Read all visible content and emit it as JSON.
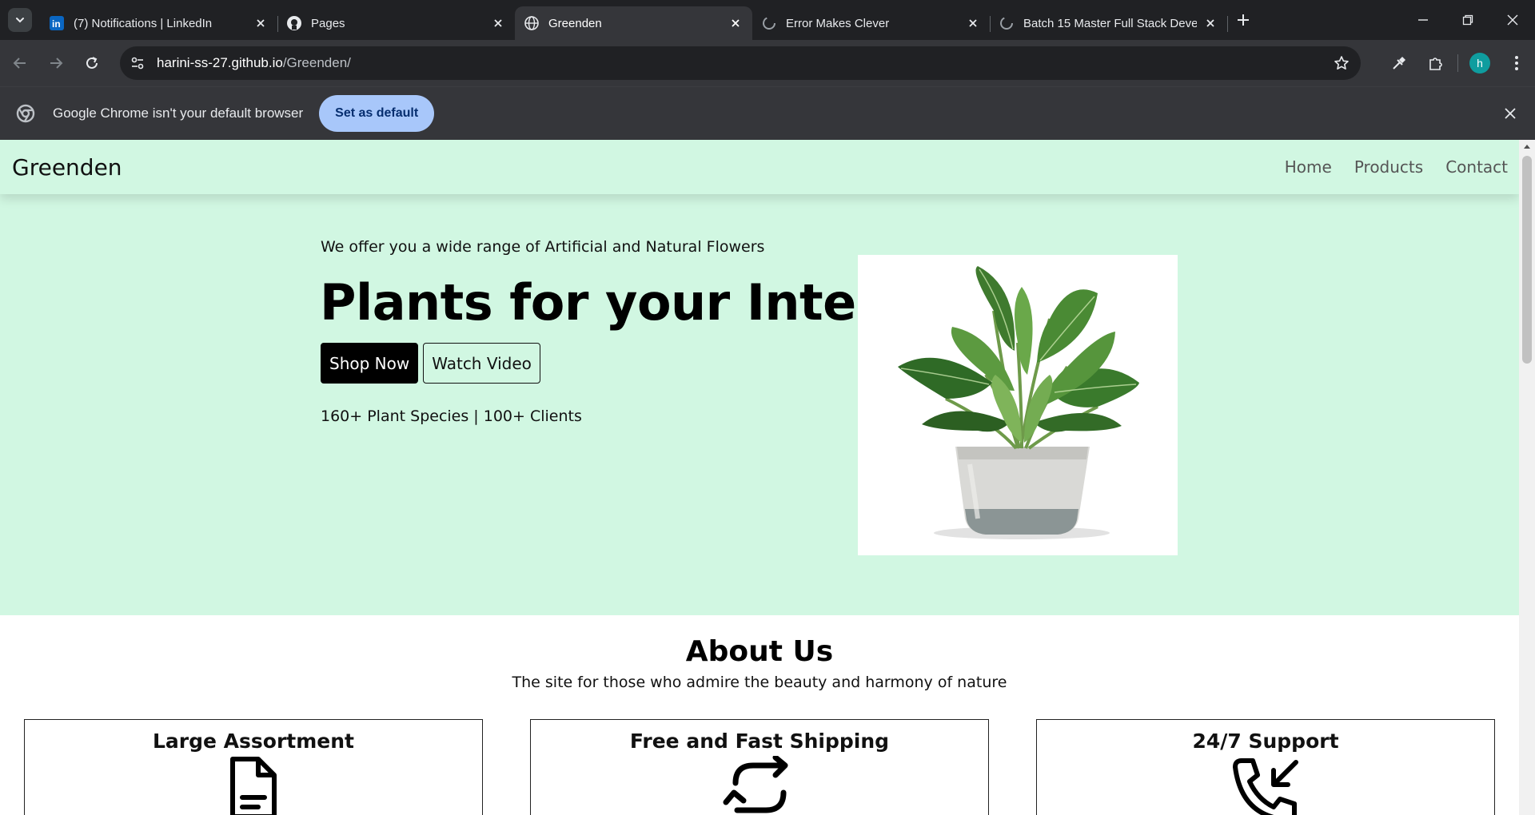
{
  "browser": {
    "tabs": [
      {
        "title": "(7) Notifications | LinkedIn",
        "favicon": "linkedin-icon",
        "active": false
      },
      {
        "title": "Pages",
        "favicon": "github-icon",
        "active": false
      },
      {
        "title": "Greenden",
        "favicon": "globe-icon",
        "active": true
      },
      {
        "title": "Error Makes Clever",
        "favicon": "emc-icon",
        "active": false
      },
      {
        "title": "Batch 15 Master Full Stack Deve",
        "favicon": "emc-icon",
        "active": false
      }
    ],
    "url_host": "harini-ss-27.github.io",
    "url_path": "/Greenden/",
    "profile_initial": "h",
    "infobar": {
      "message": "Google Chrome isn't your default browser",
      "button_label": "Set as default"
    }
  },
  "site": {
    "brand": "Greenden",
    "nav": [
      "Home",
      "Products",
      "Contact"
    ],
    "hero": {
      "subtitle": "We offer you a wide range of Artificial and Natural Flowers",
      "title": "Plants for your Interior",
      "shop_button": "Shop Now",
      "video_button": "Watch Video",
      "stats": "160+ Plant Species | 100+ Clients"
    },
    "about": {
      "title": "About Us",
      "subtitle": "The site for those who admire the beauty and harmony of nature",
      "cards": [
        {
          "title": "Large Assortment",
          "icon": "document-icon"
        },
        {
          "title": "Free and Fast Shipping",
          "icon": "refresh-arrows-icon"
        },
        {
          "title": "24/7 Support",
          "icon": "phone-incoming-icon"
        }
      ]
    }
  },
  "colors": {
    "hero_background": "#d1f7e2",
    "chrome_dark": "#202124",
    "chrome_toolbar": "#35363a",
    "set_default_button": "#a8c7fa"
  }
}
